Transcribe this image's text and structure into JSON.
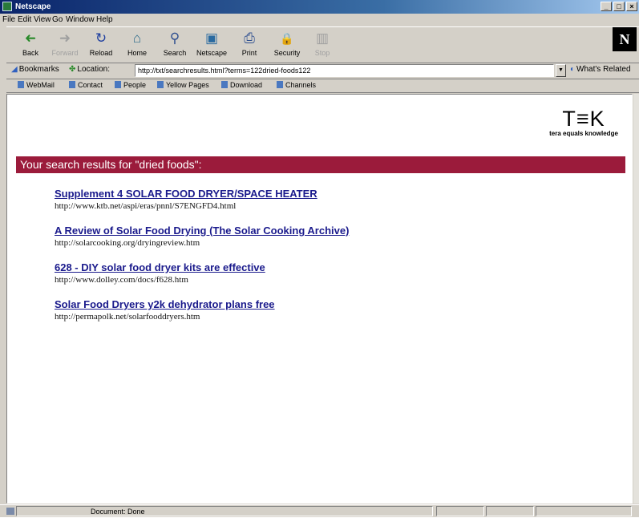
{
  "window": {
    "title": "Netscape"
  },
  "menu": [
    "File",
    "Edit",
    "View",
    "Go",
    "Window",
    "Help"
  ],
  "toolbar": {
    "buttons": [
      {
        "label": "Back",
        "icon": "back-arrow-icon",
        "glyph": "➜"
      },
      {
        "label": "Forward",
        "icon": "forward-arrow-icon",
        "glyph": "➜"
      },
      {
        "label": "Reload",
        "icon": "reload-icon",
        "glyph": "↻"
      },
      {
        "label": "Home",
        "icon": "home-icon",
        "glyph": "⌂"
      },
      {
        "label": "Search",
        "icon": "search-icon",
        "glyph": "⚲"
      },
      {
        "label": "Netscape",
        "icon": "netscape-icon",
        "glyph": "▣"
      },
      {
        "label": "Print",
        "icon": "print-icon",
        "glyph": "⎙"
      },
      {
        "label": "Security",
        "icon": "lock-icon",
        "glyph": "🔒"
      },
      {
        "label": "Stop",
        "icon": "stop-icon",
        "glyph": "▥"
      }
    ],
    "logo": "N"
  },
  "location": {
    "bookmarks_label": "Bookmarks",
    "location_label": "Location:",
    "url": "http://txt/searchresults.html?terms=122dried-foods122",
    "related_label": "What's Related"
  },
  "personal": [
    "WebMail",
    "Contact",
    "People",
    "Yellow Pages",
    "Download",
    "Channels"
  ],
  "page": {
    "logo_mark": "T≡K",
    "logo_tagline": "tera equals knowledge",
    "banner": "Your search results for \"dried foods\":",
    "results": [
      {
        "title": "Supplement 4   SOLAR FOOD DRYER/SPACE HEATER",
        "url": "http://www.ktb.net/aspi/eras/pnnl/S7ENGFD4.html"
      },
      {
        "title": "A Review of Solar Food Drying (The Solar Cooking Archive)",
        "url": "http://solarcooking.org/dryingreview.htm"
      },
      {
        "title": "628 - DIY solar food dryer kits are effective",
        "url": "http://www.dolley.com/docs/f628.htm"
      },
      {
        "title": "Solar Food Dryers y2k dehydrator plans free",
        "url": "http://permapolk.net/solarfooddryers.htm"
      }
    ]
  },
  "status": {
    "text": "Document: Done"
  },
  "colors": {
    "banner": "#9b1b3b",
    "link": "#1a1a8c",
    "chrome": "#d4d0c8"
  }
}
